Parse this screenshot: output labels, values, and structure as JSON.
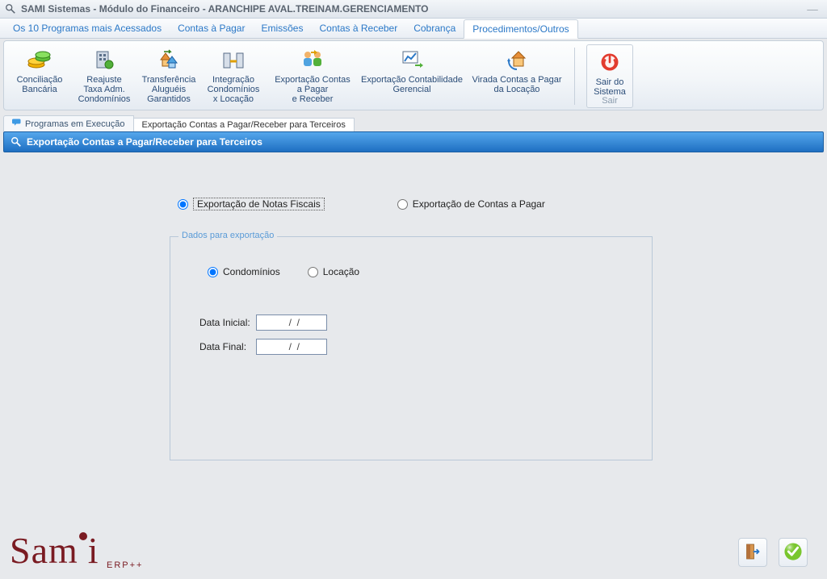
{
  "window": {
    "title": "SAMI Sistemas - Módulo do Financeiro - ARANCHIPE AVAL.TREINAM.GERENCIAMENTO"
  },
  "menu": {
    "items": [
      {
        "label": "Os 10 Programas mais Acessados",
        "active": false
      },
      {
        "label": "Contas à Pagar",
        "active": false
      },
      {
        "label": "Emissões",
        "active": false
      },
      {
        "label": "Contas à Receber",
        "active": false
      },
      {
        "label": "Cobrança",
        "active": false
      },
      {
        "label": "Procedimentos/Outros",
        "active": true
      }
    ]
  },
  "toolbar": {
    "buttons": {
      "conciliacao": "Conciliação\nBancária",
      "reajuste": "Reajuste\nTaxa Adm.\nCondomínios",
      "transferencia": "Transferência\nAluguéis\nGarantidos",
      "integracao": "Integração\nCondomínios\nx Locação",
      "exportacao_contas": "Exportação Contas\na Pagar\ne Receber",
      "exportacao_contab": "Exportação Contabilidade\nGerencial",
      "virada": "Virada Contas a Pagar\nda Locação",
      "sair": "Sair do\nSistema",
      "sair_sub": "Sair"
    }
  },
  "subtabs": {
    "programas": "Programas em Execução",
    "exportacao": "Exportação Contas a Pagar/Receber para Terceiros"
  },
  "section": {
    "title": "Exportação Contas a Pagar/Receber para Terceiros"
  },
  "form": {
    "type_options": {
      "notas_fiscais": "Exportação de Notas Fiscais",
      "contas_pagar": "Exportação de Contas a Pagar",
      "selected": "notas_fiscais"
    },
    "fieldset_legend": "Dados para exportação",
    "scope_options": {
      "condominios": "Condomínios",
      "locacao": "Locação",
      "selected": "condominios"
    },
    "date": {
      "initial_label": "Data Inicial:",
      "final_label": "Data Final:",
      "initial_value": "  /  /",
      "final_value": "  /  /"
    }
  },
  "logo": {
    "main": "Sam",
    "sub": "ERP++"
  },
  "colors": {
    "accent": "#2b78c7",
    "header_gradient_top": "#55a7ec",
    "header_gradient_bottom": "#1e6fc2",
    "brand": "#7a1b22"
  }
}
